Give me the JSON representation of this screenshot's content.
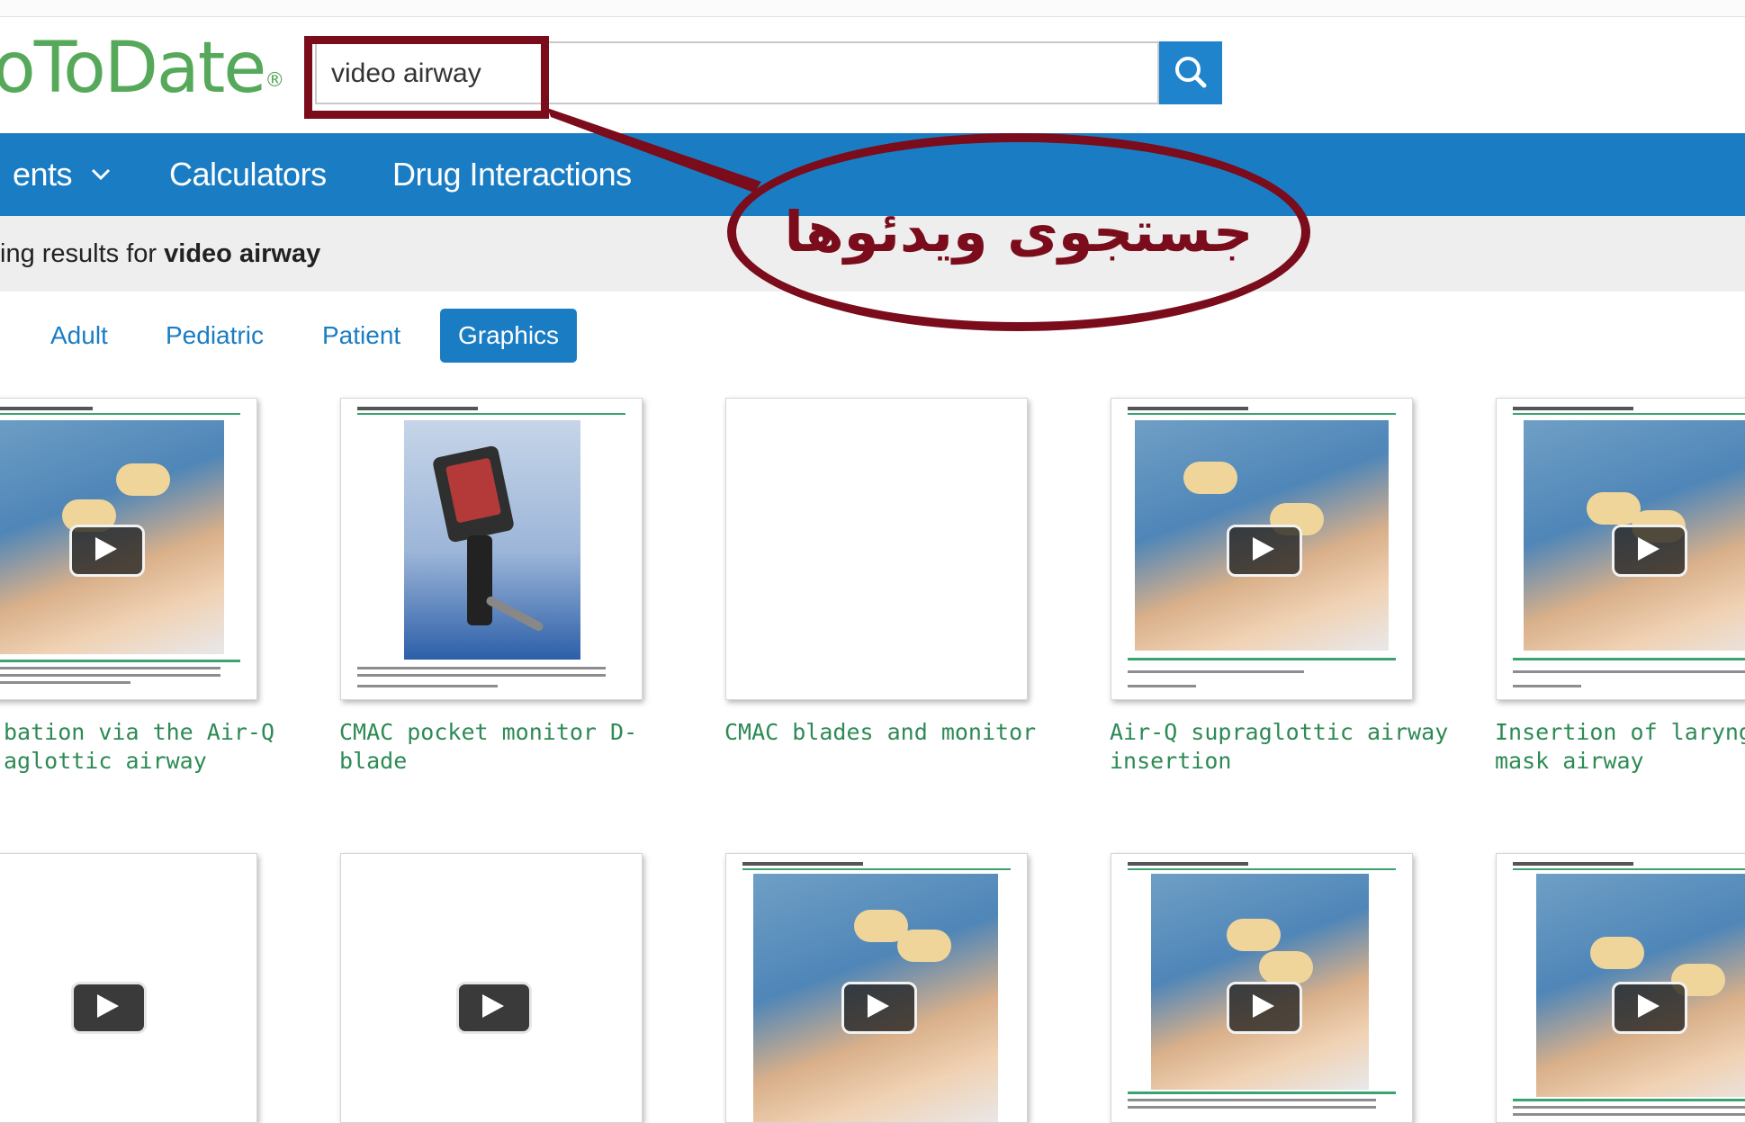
{
  "header": {
    "logo_text": "oToDate",
    "logo_mark": "®",
    "search": {
      "value": "video airway",
      "button_icon": "search-icon"
    }
  },
  "nav": {
    "items": [
      "ents",
      "Calculators",
      "Drug Interactions"
    ],
    "dropdown_icon": "chevron-down-icon"
  },
  "results": {
    "prefix": "ing results for ",
    "query": "video airway"
  },
  "filter_tabs": [
    "Adult",
    "Pediatric",
    "Patient",
    "Graphics"
  ],
  "active_tab": "Graphics",
  "graphics": [
    {
      "title_line1": "bation via the Air-Q",
      "title_line2": "aglottic airway",
      "kind": "video"
    },
    {
      "title_line1": "CMAC pocket monitor D-",
      "title_line2": "blade",
      "kind": "image"
    },
    {
      "title_line1": "CMAC blades and monitor",
      "title_line2": "",
      "kind": "image-blank"
    },
    {
      "title_line1": "Air-Q supraglottic airway",
      "title_line2": "insertion",
      "kind": "video"
    },
    {
      "title_line1": "Insertion of laryngeal",
      "title_line2": "mask airway",
      "kind": "video"
    },
    {
      "title_line1": "",
      "title_line2": "",
      "kind": "video-blank"
    },
    {
      "title_line1": "",
      "title_line2": "",
      "kind": "video-blank"
    },
    {
      "title_line1": "",
      "title_line2": "",
      "kind": "video"
    },
    {
      "title_line1": "",
      "title_line2": "",
      "kind": "video"
    },
    {
      "title_line1": "",
      "title_line2": "",
      "kind": "video"
    }
  ],
  "annotation": {
    "label": "جستجوی ویدئوها",
    "color": "#7a0c1c"
  },
  "colors": {
    "brand_green": "#56a85a",
    "nav_blue": "#1a7dc4",
    "link_green": "#2e8a55"
  }
}
